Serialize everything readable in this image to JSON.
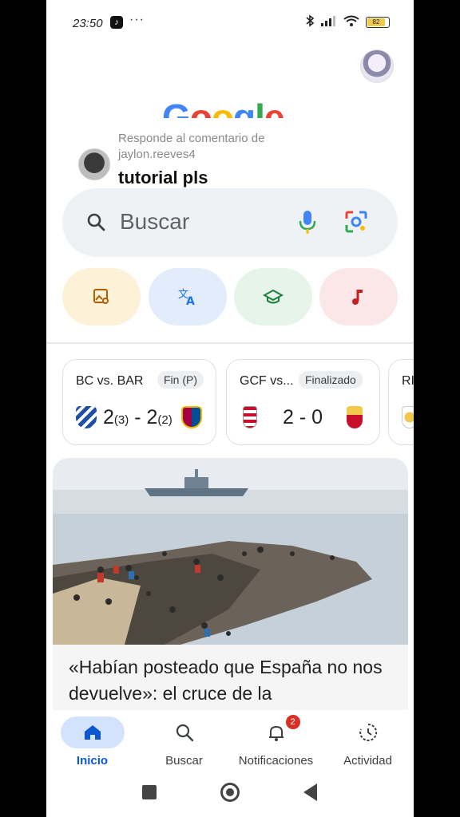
{
  "status_bar": {
    "time": "23:50",
    "dots": "···",
    "battery": "82"
  },
  "reply_overlay": {
    "caption": "Responde al comentario de jaylon.reeves4",
    "message": "tutorial pls"
  },
  "google_logo": [
    "G",
    "o",
    "o",
    "g",
    "l",
    "e"
  ],
  "search": {
    "placeholder": "Buscar"
  },
  "chips": [
    {
      "name": "image-search-icon",
      "color": "#b06000"
    },
    {
      "name": "translate-icon",
      "color": "#1a73e8"
    },
    {
      "name": "homework-icon",
      "color": "#188038"
    },
    {
      "name": "music-icon",
      "color": "#c5221f"
    }
  ],
  "score_cards": [
    {
      "title": "BC vs. BAR",
      "status": "Fin (P)",
      "home": "2",
      "home_pen": "(3)",
      "sep": " - ",
      "away": "2",
      "away_pen": "(2)"
    },
    {
      "title": "GCF vs...",
      "status": "Finalizado",
      "home": "2",
      "sep": " - ",
      "away": "0"
    },
    {
      "title": "RI"
    }
  ],
  "news": {
    "headline": "«Habían posteado que España no nos devuelve»: el cruce de la"
  },
  "bottom_nav": [
    {
      "label": "Inicio",
      "active": true
    },
    {
      "label": "Buscar",
      "active": false
    },
    {
      "label": "Notificaciones",
      "active": false,
      "badge": "2"
    },
    {
      "label": "Actividad",
      "active": false
    }
  ],
  "colors": {
    "accent": "#0b57d0",
    "badge": "#d93025"
  }
}
